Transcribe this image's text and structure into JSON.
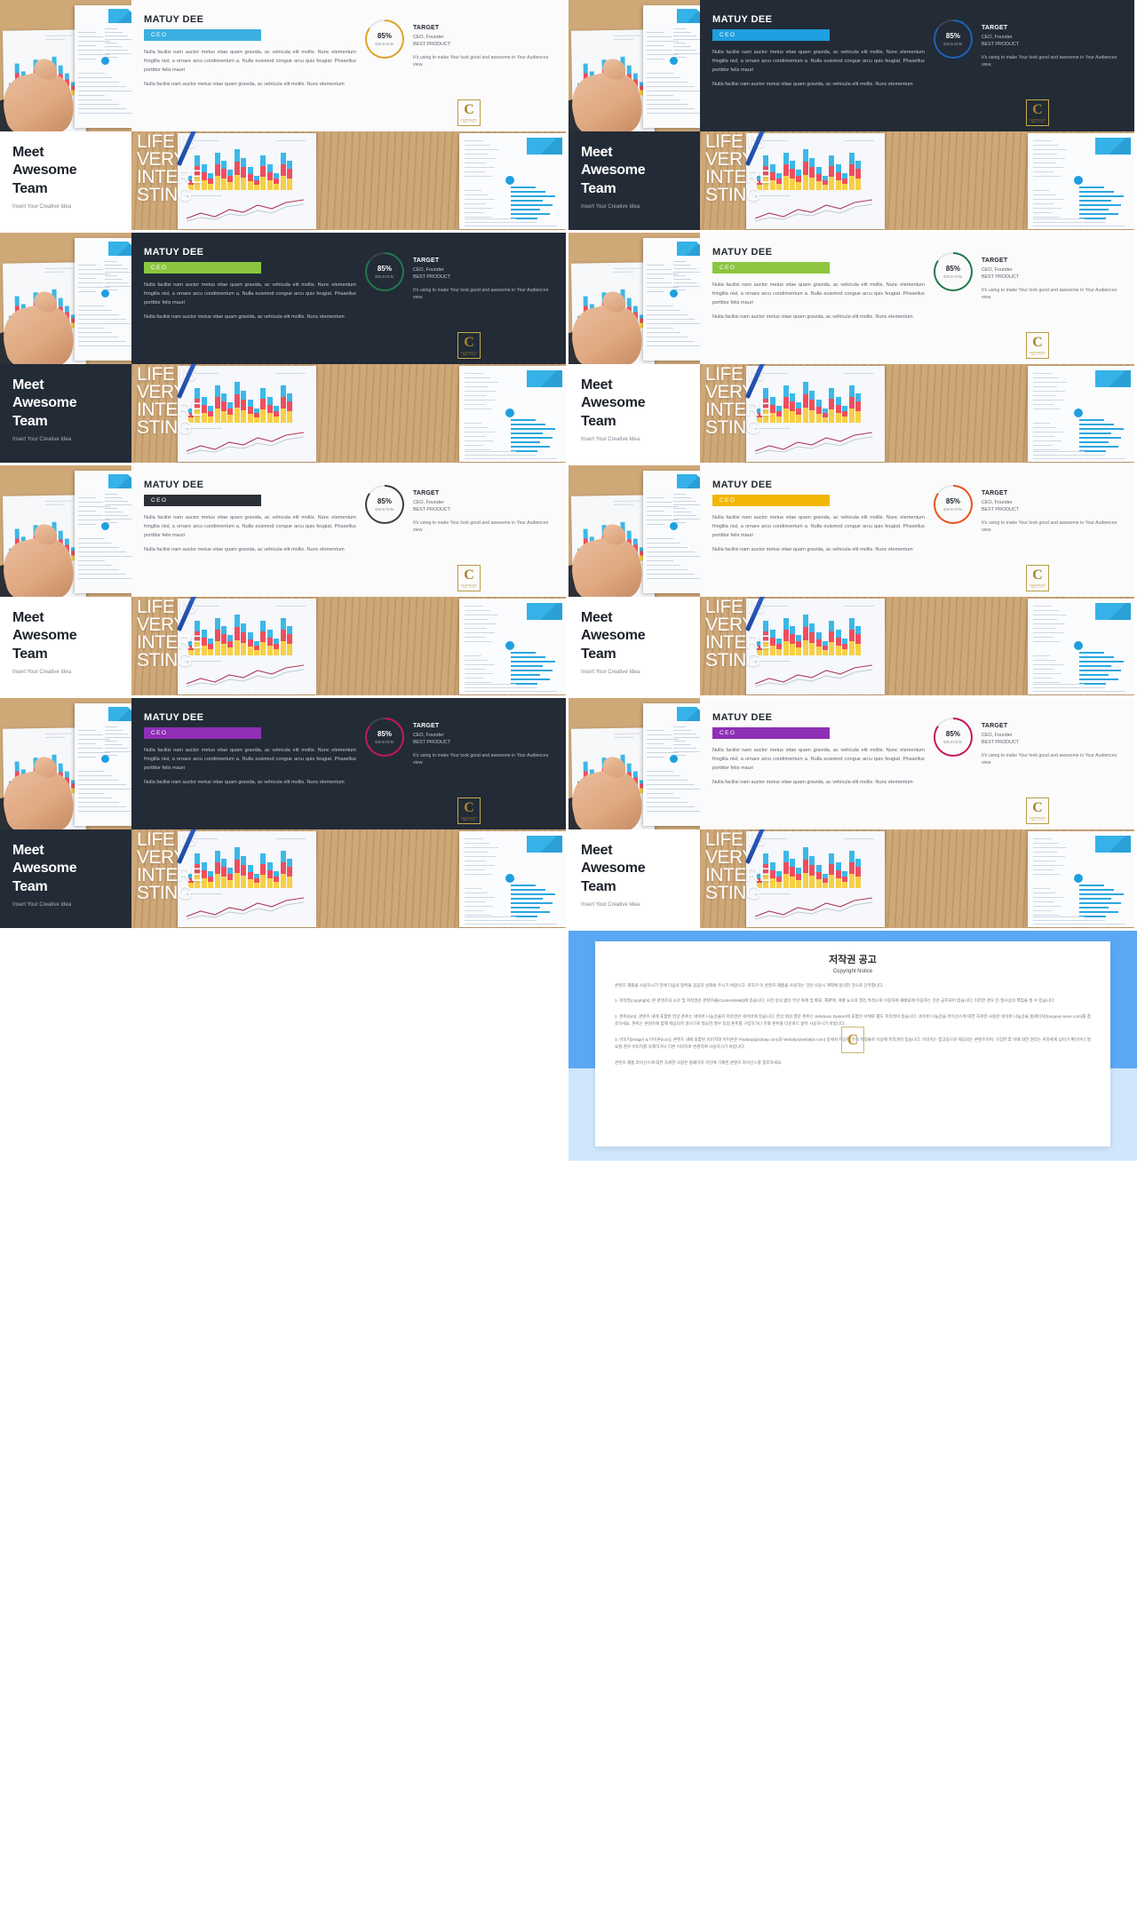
{
  "profile": {
    "name": "MATUY DEE",
    "role": "CEO",
    "paragraph1": "Nulla facilisi nam auctor metus vitae quam gravida, ac vehicula elit mollis. Nunc elementum fringilla nisl, a ornare arcu condimentum a. Nulla euismod congue arcu quis feugiat. Phasellus porttitor felis mauri",
    "paragraph2": "Nulla facilisi nam auctor metus vitae quam gravida, ac vehicula elit mollis. Nunc elementum",
    "ring_percent": "85%",
    "ring_label": "DESIGN",
    "target_title": "TARGET",
    "target_sub_line1": "CEO, Founder",
    "target_sub_line2": "BEST PRODUCT",
    "target_body": "It's using to make Your look good and awesome in Your Audiences view.",
    "logo_letter": "C",
    "logo_text": "CONTENTS",
    "logo_text2": "MALL.COM"
  },
  "team": {
    "heading_line1": "Meet",
    "heading_line2": "Awesome",
    "heading_line3": "Team",
    "subtitle": "Insert Your Creative Idea",
    "big_word_line1": "LIFE IS",
    "big_word_line2": "VERY",
    "big_word_line3": "INTERE",
    "big_word_line4": "STING"
  },
  "colors": {
    "accent_orange": "#e0a32b",
    "accent_blue": "#2aa7e0",
    "accent_navy": "#1b4f8f",
    "accent_green": "#8cc63f",
    "accent_darkgreen": "#1f7a4d",
    "accent_gray": "#8d939c",
    "accent_black": "#2b2f36",
    "accent_yellow": "#f2c10e",
    "accent_orangered": "#e8541f",
    "accent_purple": "#8e2fb5",
    "accent_magenta": "#c4185f",
    "dark_bg": "#222b36",
    "light_bg": "#fbfbfb"
  },
  "cards": [
    {
      "id": 1,
      "theme": "light",
      "badge_color": "#3bb0e0",
      "ring_color": "#e0a32b"
    },
    {
      "id": 2,
      "theme": "dark",
      "badge_color": "#1f9fe0",
      "ring_color": "#1b63b5"
    },
    {
      "id": 3,
      "theme": "light",
      "badge_color": "#3bb0e0",
      "ring_color": "#1f3f7a"
    },
    {
      "id": 4,
      "theme": "dark",
      "badge_color": "#8cc63f",
      "ring_color": "#1f7a4d"
    },
    {
      "id": 5,
      "theme": "light",
      "badge_color": "#8cc63f",
      "ring_color": "#1f7a4d"
    },
    {
      "id": 6,
      "theme": "dark",
      "badge_color": "#8d939c",
      "ring_color": "#aeb6c2"
    },
    {
      "id": 7,
      "theme": "light",
      "badge_color": "#2b2f36",
      "ring_color": "#3a4049"
    },
    {
      "id": 8,
      "theme": "light",
      "badge_color": "#f2b705",
      "ring_color": "#e8541f"
    },
    {
      "id": 9,
      "theme": "dark",
      "badge_color": "#f2c10e",
      "ring_color": "#e8541f"
    },
    {
      "id": 10,
      "theme": "dark",
      "badge_color": "#8e2fb5",
      "ring_color": "#c4185f"
    },
    {
      "id": 11,
      "theme": "light",
      "badge_color": "#8e2fb5",
      "ring_color": "#c4185f"
    }
  ],
  "copyright": {
    "title": "저작권 공고",
    "subtitle": "Copyright Notice",
    "intro": "콘텐츠 제품을 사용하시기 전에 다음의 항목을 꼼꼼히 살펴봐 주시기 바랍니다. 귀하가 이 콘텐츠 제품을 사용하는 것만 사용시 계약에 동의한 것으로 간주합니다.",
    "item1": "1. 저작권(copyright): 본 콘텐츠의 소유 및 저작권은 콘텐츠몰(ContentsMall)에 있습니다. 사전 승낙 없이 무단 복제 및 배포, 재판매, 개별 요소의 영리 목적으로 이용하여 재배포에 이용하는 것은 금지되어 있습니다. 이러한 경우 민·형사상의 책임을 질 수 있습니다.",
    "item2": "2. 폰트(font): 콘텐츠 내에 포함된 한글 폰트는 네이버 나눔글꼴의 저작권은 네이버에 있습니다. 한글 외의 영문 폰트는 Windows System에 포함된 서체로 별도 저작권이 있습니다. 네이버 나눔글꼴 라이선스에 대한 자세한 사항은 네이버 나눔글꼴 홈페이지(hangeul.naver.com)를 참조하세요. 폰트는 콘텐츠에 함께 제공되지 않으므로 필요한 경우 직접 폰트를 구입하거나 무료 폰트를 다운로드 받아 사용하시기 바랍니다.",
    "item3": "3. 이미지(image) & 아이콘(icon): 콘텐츠 내에 포함된 이미지와 아이콘은 Pixabay(pixabay.com)과 Webalys(webalys.com) 등에서 제공된 무료 저작물로 이용에 저작권이 있습니다. 이미지는 참고용으로 제공되는 콘텐츠이며, 구입한 후 이에 대한 권리는 귀하에게 넘어가 확인이나 필요할 경우 이미지를 삭제하거나 다른 이미지로 변경하여 사용하시기 바랍니다.",
    "outro": "콘텐츠 제품 라이선스에 대한 자세한 사항은 홈페이지 하단에 기재된 콘텐츠 라이선스를 참조하세요.",
    "watermark_letter": "C"
  }
}
